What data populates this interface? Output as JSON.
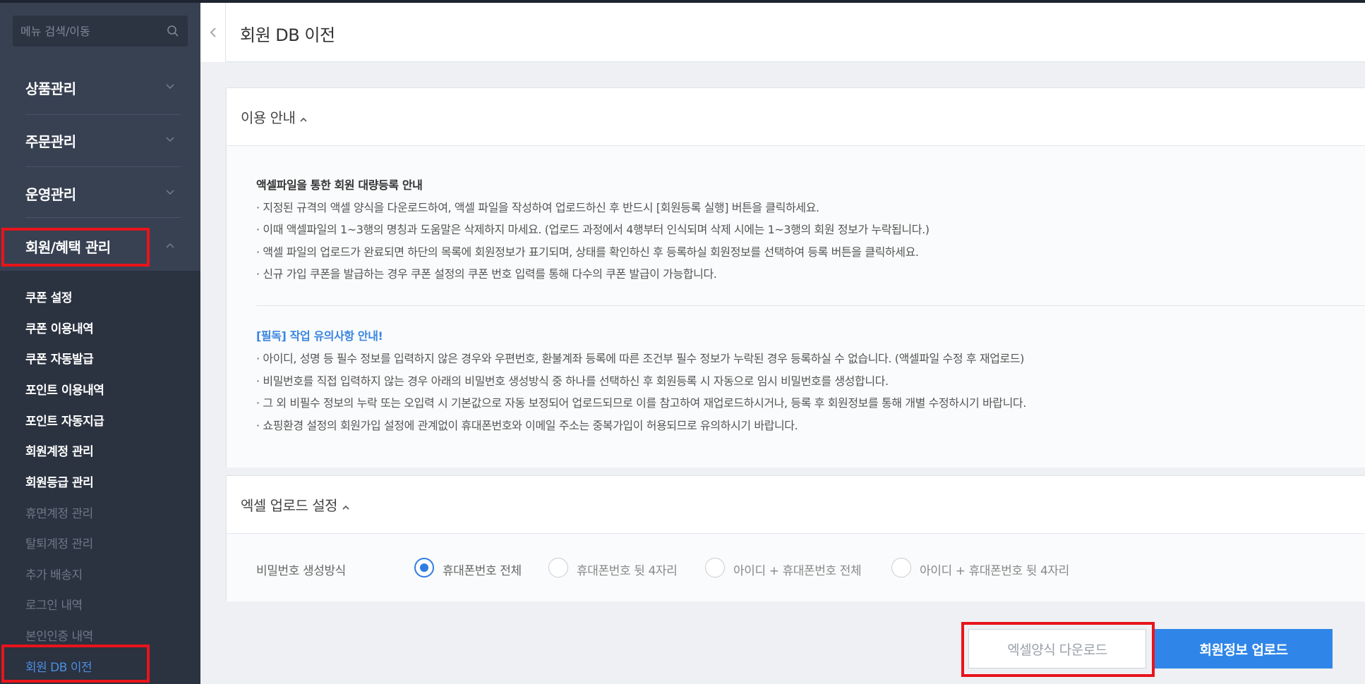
{
  "sidebar": {
    "search_placeholder": "메뉴 검색/이동",
    "menus": [
      {
        "label": "상품관리"
      },
      {
        "label": "주문관리"
      },
      {
        "label": "운영관리"
      },
      {
        "label": "회원/혜택 관리"
      }
    ],
    "submenu": [
      {
        "label": "쿠폰 설정",
        "state": "normal"
      },
      {
        "label": "쿠폰 이용내역",
        "state": "normal"
      },
      {
        "label": "쿠폰 자동발급",
        "state": "normal"
      },
      {
        "label": "포인트 이용내역",
        "state": "normal"
      },
      {
        "label": "포인트 자동지급",
        "state": "normal"
      },
      {
        "label": "회원계정 관리",
        "state": "normal"
      },
      {
        "label": "회원등급 관리",
        "state": "normal"
      },
      {
        "label": "휴면계정 관리",
        "state": "dim"
      },
      {
        "label": "탈퇴계정 관리",
        "state": "dim"
      },
      {
        "label": "추가 배송지",
        "state": "dim"
      },
      {
        "label": "로그인 내역",
        "state": "dim"
      },
      {
        "label": "본인인증 내역",
        "state": "dim"
      },
      {
        "label": "회원 DB 이전",
        "state": "active"
      }
    ]
  },
  "header": {
    "title": "회원 DB 이전"
  },
  "usage_guide": {
    "title": "이용 안내",
    "section1_title": "액셀파일을 통한 회원 대량등록 안내",
    "section1_lines": [
      "· 지정된 규격의 액셀 양식을 다운로드하여, 액셀 파일을 작성하여 업로드하신 후 반드시 [회원등록 실행] 버튼을 클릭하세요.",
      "· 이때 액셀파일의 1~3행의 명칭과 도움말은 삭제하지 마세요. (업로드 과정에서 4행부터 인식되며 삭제 시에는 1~3행의 회원 정보가 누락됩니다.)",
      "· 액셀 파일의 업로드가 완료되면 하단의 목록에 회원정보가 표기되며, 상태를 확인하신 후 등록하실 회원정보를 선택하여 등록 버튼을 클릭하세요.",
      "· 신규 가입 쿠폰을 발급하는 경우 쿠폰 설정의 쿠폰 번호 입력를 통해 다수의 쿠폰 발급이 가능합니다."
    ],
    "section2_title": "[필독] 작업 유의사항 안내!",
    "section2_lines": [
      "· 아이디, 성명 등 필수 정보를 입력하지 않은 경우와 우편번호, 환불계좌 등록에 따른 조건부 필수 정보가 누락된 경우 등록하실 수 없습니다. (액셀파일 수정 후 재업로드)",
      "· 비밀번호를 직접 입력하지 않는 경우 아래의 비밀번호 생성방식 중 하나를 선택하신 후 회원등록 시 자동으로 임시 비밀번호를 생성합니다.",
      "· 그 외 비필수 정보의 누락 또는 오입력 시 기본값으로 자동 보정되어 업로드되므로 이를 참고하여 재업로드하시거나, 등록 후 회원정보를 통해 개별 수정하시기 바랍니다.",
      "· 쇼핑환경 설정의 회원가입 설정에 관계없이 휴대폰번호와 이메일 주소는 중복가입이 허용되므로 유의하시기 바랍니다."
    ]
  },
  "upload_settings": {
    "title": "엑셀 업로드 설정",
    "password_label": "비밀번호 생성방식",
    "options": [
      {
        "label": "휴대폰번호 전체",
        "selected": true
      },
      {
        "label": "휴대폰번호 뒷 4자리",
        "selected": false
      },
      {
        "label": "아이디 + 휴대폰번호 전체",
        "selected": false
      },
      {
        "label": "아이디 + 휴대폰번호 뒷 4자리",
        "selected": false
      }
    ]
  },
  "actions": {
    "download_label": "엑셀양식 다운로드",
    "upload_label": "회원정보 업로드"
  },
  "colors": {
    "sidebar_bg": "#384152",
    "submenu_bg": "#2b3240",
    "accent": "#2f86e8",
    "highlight": "#e8141b"
  }
}
